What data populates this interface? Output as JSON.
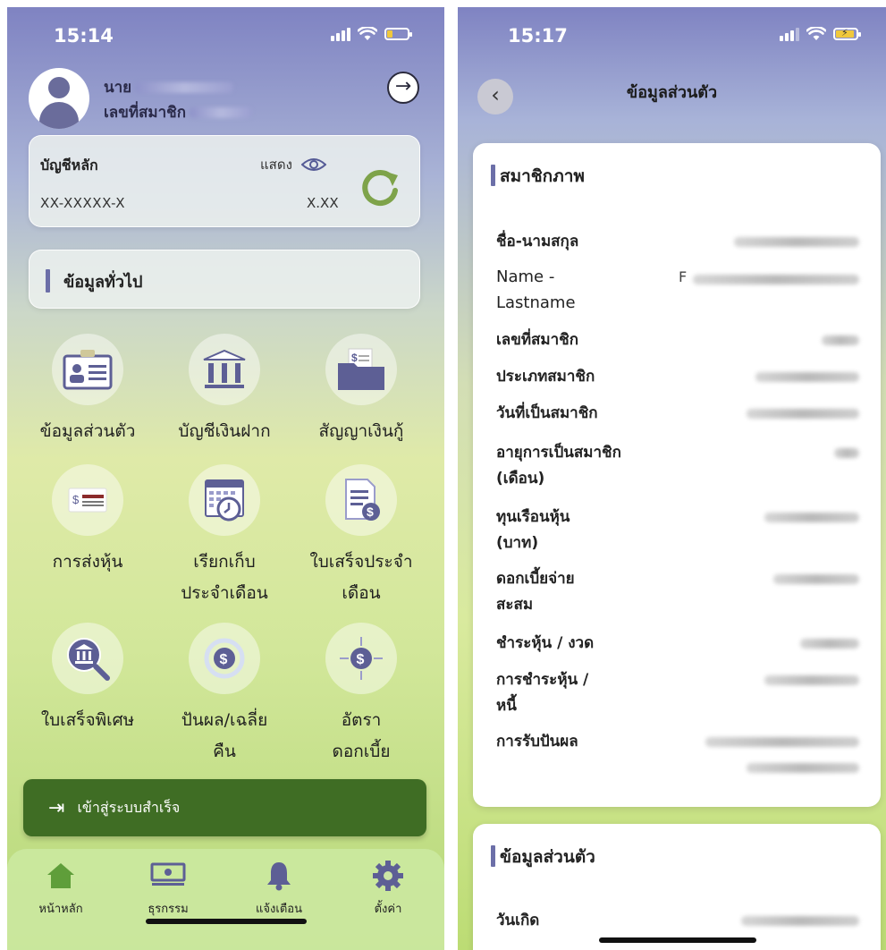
{
  "left_screen": {
    "status_time": "15:14",
    "user": {
      "name_prefix": "นาย",
      "member_no_label": "เลขที่สมาชิก"
    },
    "account": {
      "title": "บัญชีหลัก",
      "show_label": "แสดง",
      "account_number": "XX-XXXXX-X",
      "balance": "X.XX"
    },
    "general_section": "ข้อมูลทั่วไป",
    "menu": [
      {
        "label": "ข้อมูลส่วนตัว",
        "icon": "id-card-icon"
      },
      {
        "label": "บัญชีเงินฝาก",
        "icon": "bank-icon"
      },
      {
        "label": "สัญญาเงินกู้",
        "icon": "folder-document-icon"
      },
      {
        "label": "การส่งหุ้น",
        "icon": "cash-card-icon"
      },
      {
        "label": "เรียกเก็บประจำเดือน",
        "icon": "calendar-clock-icon"
      },
      {
        "label": "ใบเสร็จประจำเดือน",
        "icon": "receipt-dollar-icon"
      },
      {
        "label": "ใบเสร็จพิเศษ",
        "icon": "bank-search-icon"
      },
      {
        "label": "ปันผล/เฉลี่ยคืน",
        "icon": "dollar-cycle-icon"
      },
      {
        "label": "อัตราดอกเบี้ย",
        "icon": "dollar-target-icon"
      }
    ],
    "toast": "เข้าสู่ระบบสำเร็จ",
    "tabs": [
      {
        "label": "หน้าหลัก",
        "icon": "home-icon"
      },
      {
        "label": "ธุรกรรม",
        "icon": "banknote-icon"
      },
      {
        "label": "แจ้งเตือน",
        "icon": "bell-icon"
      },
      {
        "label": "ตั้งค่า",
        "icon": "gear-icon"
      }
    ],
    "colors": {
      "accent": "#6c6fa8",
      "toast": "#3f6d24",
      "refresh": "#7ea34a"
    }
  },
  "right_screen": {
    "status_time": "15:17",
    "title": "ข้อมูลส่วนตัว",
    "membership_section": "สมาชิกภาพ",
    "fields": [
      {
        "label": "ชื่อ-นามสกุล"
      },
      {
        "label": "Name - Lastname",
        "value_prefix": "F"
      },
      {
        "label": "เลขที่สมาชิก"
      },
      {
        "label": "ประเภทสมาชิก"
      },
      {
        "label": "วันที่เป็นสมาชิก"
      },
      {
        "label": "อายุการเป็นสมาชิก (เดือน)"
      },
      {
        "label": "ทุนเรือนหุ้น (บาท)"
      },
      {
        "label": "ดอกเบี้ยจ่ายสะสม"
      },
      {
        "label": "ชำระหุ้น / งวด"
      },
      {
        "label": "การชำระหุ้น / หนี้"
      },
      {
        "label": "การรับปันผล"
      }
    ],
    "personal_section": "ข้อมูลส่วนตัว",
    "personal_fields": [
      {
        "label": "วันเกิด"
      }
    ]
  }
}
